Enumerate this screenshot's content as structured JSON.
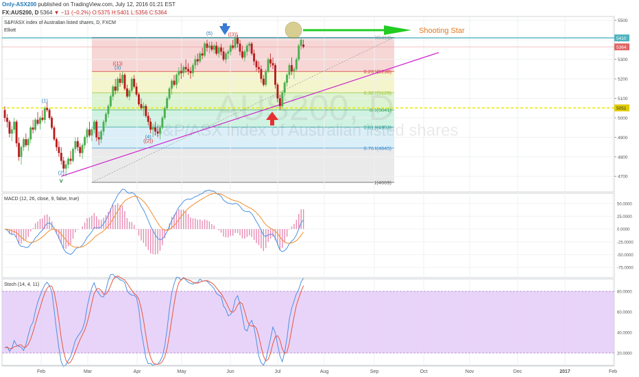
{
  "header": {
    "publisher": "Only-ASX200",
    "published_text": "published on TradingView.com, July 12, 2016 01:21 EST",
    "symbol": "FX:AUS200, D",
    "last": "5364",
    "change": "▼ −11 (−0.2%)",
    "ohlc": "O:5375 H:5401 L:5356 C:5364"
  },
  "colors": {
    "candle_up": "#4caf50",
    "candle_down": "#b71c1c",
    "macd_line": "#4a90e2",
    "signal_line": "#f28c28",
    "histogram": "#e58ab2",
    "stoch_k": "#4a90e2",
    "stoch_d": "#e8553c",
    "stoch_band": "#e3c9f7",
    "trendline": "#cc22cc",
    "support": "#e9e900",
    "resistance": "#4fb3bf",
    "arrow_green": "#22cc22",
    "arrow_red": "#e53030",
    "arrow_blue": "#3a7bd5",
    "marker_circle": "#b9a73a"
  },
  "chart_data": [
    {
      "type": "candlestick",
      "title": "S&P/ASX index of Australian listed shares, D, FXCM",
      "subtitle": "Elliott",
      "watermark": "AUS200, D",
      "watermark_sub": "S&P/ASX index of Australian listed shares",
      "x_ticks": [
        "Feb",
        "Mar",
        "Apr",
        "May",
        "Jun",
        "Jul",
        "Aug",
        "Sep",
        "Oct",
        "Nov",
        "Dec",
        "2017",
        "Feb"
      ],
      "y_ticks": [
        4700,
        4800,
        4900,
        5000,
        5100,
        5200,
        5300,
        5400,
        5500
      ],
      "ylim": [
        4620,
        5520
      ],
      "candles": [
        [
          5040,
          5060,
          4980,
          5000
        ],
        [
          5000,
          5020,
          4950,
          4980
        ],
        [
          4980,
          4990,
          4900,
          4920
        ],
        [
          4920,
          4960,
          4880,
          4940
        ],
        [
          4940,
          5000,
          4920,
          4980
        ],
        [
          4980,
          4990,
          4850,
          4870
        ],
        [
          4870,
          4900,
          4780,
          4800
        ],
        [
          4800,
          4860,
          4760,
          4850
        ],
        [
          4850,
          4900,
          4830,
          4890
        ],
        [
          4890,
          4920,
          4850,
          4860
        ],
        [
          4860,
          4900,
          4830,
          4890
        ],
        [
          4890,
          4960,
          4870,
          4950
        ],
        [
          4950,
          4990,
          4920,
          4940
        ],
        [
          4940,
          5000,
          4930,
          4990
        ],
        [
          4990,
          5030,
          4960,
          4970
        ],
        [
          4970,
          5010,
          4940,
          5000
        ],
        [
          5000,
          5040,
          4980,
          4990
        ],
        [
          4990,
          5060,
          4970,
          5050
        ],
        [
          5050,
          5080,
          5030,
          5040
        ],
        [
          5040,
          5050,
          4990,
          5000
        ],
        [
          5000,
          5010,
          4940,
          4950
        ],
        [
          4950,
          4960,
          4880,
          4890
        ],
        [
          4890,
          4900,
          4830,
          4850
        ],
        [
          4850,
          4880,
          4800,
          4820
        ],
        [
          4820,
          4850,
          4760,
          4780
        ],
        [
          4780,
          4800,
          4720,
          4740
        ],
        [
          4740,
          4780,
          4700,
          4760
        ],
        [
          4760,
          4800,
          4740,
          4790
        ],
        [
          4790,
          4830,
          4760,
          4780
        ],
        [
          4780,
          4850,
          4770,
          4840
        ],
        [
          4840,
          4900,
          4820,
          4880
        ],
        [
          4880,
          4900,
          4830,
          4850
        ],
        [
          4850,
          4870,
          4800,
          4820
        ],
        [
          4820,
          4870,
          4790,
          4860
        ],
        [
          4860,
          4910,
          4840,
          4900
        ],
        [
          4900,
          4950,
          4870,
          4940
        ],
        [
          4940,
          4980,
          4900,
          4910
        ],
        [
          4910,
          4950,
          4880,
          4940
        ],
        [
          4940,
          4990,
          4920,
          4980
        ],
        [
          4980,
          4990,
          4880,
          4900
        ],
        [
          4900,
          4930,
          4860,
          4890
        ],
        [
          4890,
          4940,
          4870,
          4930
        ],
        [
          4930,
          4990,
          4910,
          4980
        ],
        [
          4980,
          5030,
          4960,
          5020
        ],
        [
          5020,
          5070,
          5000,
          5060
        ],
        [
          5060,
          5120,
          5050,
          5110
        ],
        [
          5110,
          5170,
          5090,
          5160
        ],
        [
          5160,
          5200,
          5120,
          5140
        ],
        [
          5140,
          5210,
          5130,
          5200
        ],
        [
          5200,
          5230,
          5160,
          5180
        ],
        [
          5180,
          5240,
          5170,
          5220
        ],
        [
          5220,
          5230,
          5140,
          5150
        ],
        [
          5150,
          5170,
          5100,
          5110
        ],
        [
          5110,
          5150,
          5090,
          5140
        ],
        [
          5140,
          5210,
          5130,
          5200
        ],
        [
          5200,
          5220,
          5150,
          5160
        ],
        [
          5160,
          5180,
          5110,
          5120
        ],
        [
          5120,
          5130,
          5060,
          5070
        ],
        [
          5070,
          5100,
          5040,
          5050
        ],
        [
          5050,
          5080,
          5010,
          5060
        ],
        [
          5060,
          5070,
          5000,
          5010
        ],
        [
          5010,
          5030,
          4960,
          4980
        ],
        [
          4980,
          5000,
          4920,
          4940
        ],
        [
          4940,
          4970,
          4900,
          4950
        ],
        [
          4950,
          4980,
          4910,
          4930
        ],
        [
          4930,
          4960,
          4900,
          4920
        ],
        [
          4920,
          4960,
          4890,
          4950
        ],
        [
          4950,
          5010,
          4940,
          5000
        ],
        [
          5000,
          5060,
          4990,
          5050
        ],
        [
          5050,
          5110,
          5040,
          5100
        ],
        [
          5100,
          5160,
          5090,
          5150
        ],
        [
          5150,
          5200,
          5120,
          5190
        ],
        [
          5190,
          5220,
          5160,
          5170
        ],
        [
          5170,
          5230,
          5150,
          5220
        ],
        [
          5220,
          5260,
          5180,
          5240
        ],
        [
          5240,
          5280,
          5200,
          5230
        ],
        [
          5230,
          5270,
          5210,
          5260
        ],
        [
          5260,
          5300,
          5230,
          5250
        ],
        [
          5250,
          5280,
          5220,
          5240
        ],
        [
          5240,
          5260,
          5200,
          5230
        ],
        [
          5230,
          5280,
          5210,
          5270
        ],
        [
          5270,
          5320,
          5250,
          5300
        ],
        [
          5300,
          5330,
          5270,
          5290
        ],
        [
          5290,
          5340,
          5280,
          5330
        ],
        [
          5330,
          5360,
          5300,
          5320
        ],
        [
          5320,
          5390,
          5310,
          5380
        ],
        [
          5380,
          5400,
          5340,
          5360
        ],
        [
          5360,
          5390,
          5330,
          5370
        ],
        [
          5370,
          5390,
          5340,
          5350
        ],
        [
          5350,
          5380,
          5330,
          5370
        ],
        [
          5370,
          5390,
          5320,
          5330
        ],
        [
          5330,
          5370,
          5310,
          5360
        ],
        [
          5360,
          5380,
          5320,
          5340
        ],
        [
          5340,
          5360,
          5290,
          5300
        ],
        [
          5300,
          5340,
          5280,
          5330
        ],
        [
          5330,
          5350,
          5300,
          5340
        ],
        [
          5340,
          5380,
          5320,
          5370
        ],
        [
          5370,
          5400,
          5350,
          5360
        ],
        [
          5360,
          5420,
          5350,
          5410
        ],
        [
          5410,
          5425,
          5360,
          5380
        ],
        [
          5380,
          5400,
          5320,
          5340
        ],
        [
          5340,
          5370,
          5300,
          5310
        ],
        [
          5310,
          5350,
          5290,
          5340
        ],
        [
          5340,
          5380,
          5320,
          5370
        ],
        [
          5370,
          5390,
          5340,
          5380
        ],
        [
          5380,
          5390,
          5320,
          5330
        ],
        [
          5330,
          5350,
          5270,
          5290
        ],
        [
          5290,
          5300,
          5240,
          5260
        ],
        [
          5260,
          5290,
          5230,
          5250
        ],
        [
          5250,
          5270,
          5180,
          5200
        ],
        [
          5200,
          5220,
          5160,
          5170
        ],
        [
          5170,
          5250,
          5160,
          5240
        ],
        [
          5240,
          5310,
          5230,
          5300
        ],
        [
          5300,
          5330,
          5260,
          5280
        ],
        [
          5280,
          5310,
          5250,
          5270
        ],
        [
          5270,
          5280,
          5150,
          5170
        ],
        [
          5170,
          5180,
          5080,
          5100
        ],
        [
          5100,
          5120,
          5040,
          5060
        ],
        [
          5060,
          5140,
          5050,
          5130
        ],
        [
          5130,
          5190,
          5110,
          5180
        ],
        [
          5180,
          5230,
          5160,
          5220
        ],
        [
          5220,
          5280,
          5200,
          5270
        ],
        [
          5270,
          5310,
          5220,
          5240
        ],
        [
          5240,
          5260,
          5200,
          5250
        ],
        [
          5250,
          5310,
          5240,
          5300
        ],
        [
          5300,
          5380,
          5290,
          5370
        ],
        [
          5370,
          5410,
          5350,
          5400
        ],
        [
          5375,
          5401,
          5356,
          5364
        ]
      ],
      "fib_levels": [
        {
          "label": "0(5413)",
          "value": 5413,
          "color": "#999999",
          "fill": "#f6cfcf"
        },
        {
          "label": "0.236(5238)",
          "value": 5238,
          "color": "#d23c3c",
          "fill": "#f3f3c4"
        },
        {
          "label": "0.382(5129)",
          "value": 5129,
          "color": "#9ac43c",
          "fill": "#d6f2c9"
        },
        {
          "label": "0.5(5041)",
          "value": 5041,
          "color": "#3caa5a",
          "fill": "#c8f0dd"
        },
        {
          "label": "0.618(4953)",
          "value": 4953,
          "color": "#2aa198",
          "fill": "#d3ecf7"
        },
        {
          "label": "0.764(4845)",
          "value": 4845,
          "color": "#3a8fd5",
          "fill": "#e6e6e6"
        },
        {
          "label": "1(4669)",
          "value": 4669,
          "color": "#666666",
          "fill": ""
        }
      ],
      "price_labels": [
        {
          "label": "5410",
          "value": 5410
        },
        {
          "label": "5364",
          "value": 5364
        },
        {
          "label": "5051",
          "value": 5051
        }
      ],
      "support_level": 5051,
      "resistance_level": 5410,
      "elliott_labels": [
        {
          "label": "(1)",
          "index": 17,
          "value": 5078
        },
        {
          "label": "(2)",
          "index": 24,
          "value": 4710
        },
        {
          "label": "V",
          "index": 24,
          "value": 4668
        },
        {
          "label": "((1))",
          "index": 48,
          "value": 5270
        },
        {
          "label": "(3)",
          "index": 48,
          "value": 5250
        },
        {
          "label": "(4)",
          "index": 61,
          "value": 4895
        },
        {
          "label": "((2))",
          "index": 61,
          "value": 4873
        },
        {
          "label": "(5)",
          "index": 87,
          "value": 5425
        },
        {
          "label": "((3))",
          "index": 97,
          "value": 5420
        }
      ],
      "annotations": [
        {
          "text": "Shooting Star"
        }
      ]
    },
    {
      "type": "line",
      "title": "MACD (12, 26, close, 9, false, true)",
      "y_ticks": [
        50,
        25,
        0,
        -25,
        -50,
        -75
      ],
      "y_tick_labels": [
        "50.0000",
        "25.0000",
        "0.0000",
        "-25.0000",
        "-50.0000",
        "-75.0000"
      ],
      "ylim": [
        -95,
        70
      ],
      "series": [
        {
          "values": []
        },
        {
          "values": []
        }
      ]
    },
    {
      "type": "line",
      "title": "Stoch (14, 4, 11)",
      "y_ticks": [
        80,
        60,
        40,
        20
      ],
      "y_tick_labels": [
        "80.0000",
        "60.0000",
        "40.0000",
        "20.0000"
      ],
      "ylim": [
        8,
        92
      ],
      "band": [
        20,
        80
      ],
      "series": [
        {
          "values": []
        },
        {
          "values": []
        }
      ]
    }
  ]
}
